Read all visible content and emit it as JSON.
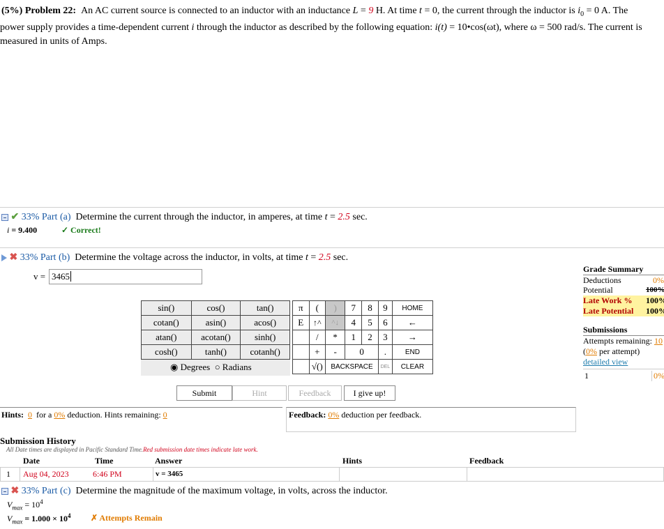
{
  "problem": {
    "header": "(5%) Problem 22:",
    "text1": "An AC current source is connected to an inductor with an inductance ",
    "L_sym": "L",
    "L_eq": " = ",
    "L_val": "9",
    "L_unit": " H. At time ",
    "t_sym": "t",
    "t_text": " = 0, the current through the inductor is ",
    "i0_sym": "i",
    "i0_sub": "0",
    "i0_text": " = 0 A. The",
    "line2": "power supply provides a time-dependent current ",
    "i_sym": "i",
    "line2b": " through the inductor as described by the following equation: ",
    "eq_left": "i(t)",
    "eq_right": " = 10•cos(ωt), where ω = 500 rad/s. The current is",
    "line3": "measured in units of Amps."
  },
  "part_a": {
    "percent": "33% Part (a)",
    "text": "Determine the current through the inductor, in amperes, at time ",
    "t_sym": "t",
    "eq": " = ",
    "t_val": "2.5",
    "unit": " sec.",
    "answer_label": "i",
    "answer_value": " = 9.400",
    "status": "✓ Correct!"
  },
  "part_b": {
    "percent": "33% Part (b)",
    "text": "Determine the voltage across the inductor, in volts, at time ",
    "t_sym": "t",
    "eq": " = ",
    "t_val": "2.5",
    "unit": " sec.",
    "input_label": "v = ",
    "input_value": "3465"
  },
  "keypad": {
    "functions": [
      [
        "sin()",
        "cos()",
        "tan()"
      ],
      [
        "cotan()",
        "asin()",
        "acos()"
      ],
      [
        "atan()",
        "acotan()",
        "sinh()"
      ],
      [
        "cosh()",
        "tanh()",
        "cotanh()"
      ]
    ],
    "degrees": "Degrees",
    "radians": "Radians",
    "pi": "π",
    "lparen": "(",
    "rparen": ")",
    "E": "E",
    "up": "↑^",
    "up2": "^↓",
    "slash": "/",
    "star": "*",
    "plus": "+",
    "minus": "-",
    "sqrt": "√()",
    "backspace": "BACKSPACE",
    "del": "DEL",
    "clear": "CLEAR",
    "home": "HOME",
    "left": "←",
    "right": "→",
    "end": "END",
    "d7": "7",
    "d8": "8",
    "d9": "9",
    "d4": "4",
    "d5": "5",
    "d6": "6",
    "d1": "1",
    "d2": "2",
    "d3": "3",
    "d0": "0",
    "dot": "."
  },
  "buttons": {
    "submit": "Submit",
    "hint": "Hint",
    "feedback": "Feedback",
    "give_up": "I give up!"
  },
  "hints": {
    "label": "Hints:",
    "count": "0",
    "for_a": "for a",
    "pct": "0%",
    "deduction": "deduction. Hints remaining:",
    "remaining": "0"
  },
  "feedback": {
    "label": "Feedback:",
    "pct": "0%",
    "text": "deduction per feedback."
  },
  "grade_summary": {
    "title": "Grade Summary",
    "deductions_label": "Deductions",
    "deductions_value": "0%",
    "potential_label": "Potential",
    "potential_value": "100%",
    "late_work_label": "Late Work %",
    "late_work_value": "100%",
    "late_potential_label": "Late Potential",
    "late_potential_value": "100%",
    "submissions_title": "Submissions",
    "attempts_label": "Attempts remaining:",
    "attempts_value": "10",
    "per_attempt_pct": "0%",
    "per_attempt_text": "per attempt)",
    "detailed_view": "detailed view",
    "row_index": "1",
    "row_pct": "0%"
  },
  "history": {
    "title": "Submission History",
    "note1": "All Date times are displayed in Pacific Standard Time.",
    "note2": "Red submission date times indicate late work.",
    "col_date": "Date",
    "col_time": "Time",
    "col_answer": "Answer",
    "col_hints": "Hints",
    "col_feedback": "Feedback",
    "rows": [
      {
        "index": "1",
        "date": "Aug 04, 2023",
        "time": "6:46 PM",
        "answer": "v = 3465"
      }
    ]
  },
  "part_c": {
    "percent": "33% Part (c)",
    "text": "Determine the magnitude of the maximum voltage, in volts, across the inductor.",
    "line1_sym": "V",
    "line1_sub": "max",
    "line1_val": " = 10",
    "line1_exp": "4",
    "line2_sym": "V",
    "line2_sub": "max",
    "line2_val": " = 1.000 × 10",
    "line2_exp": "4",
    "status": "✗ Attempts Remain"
  }
}
